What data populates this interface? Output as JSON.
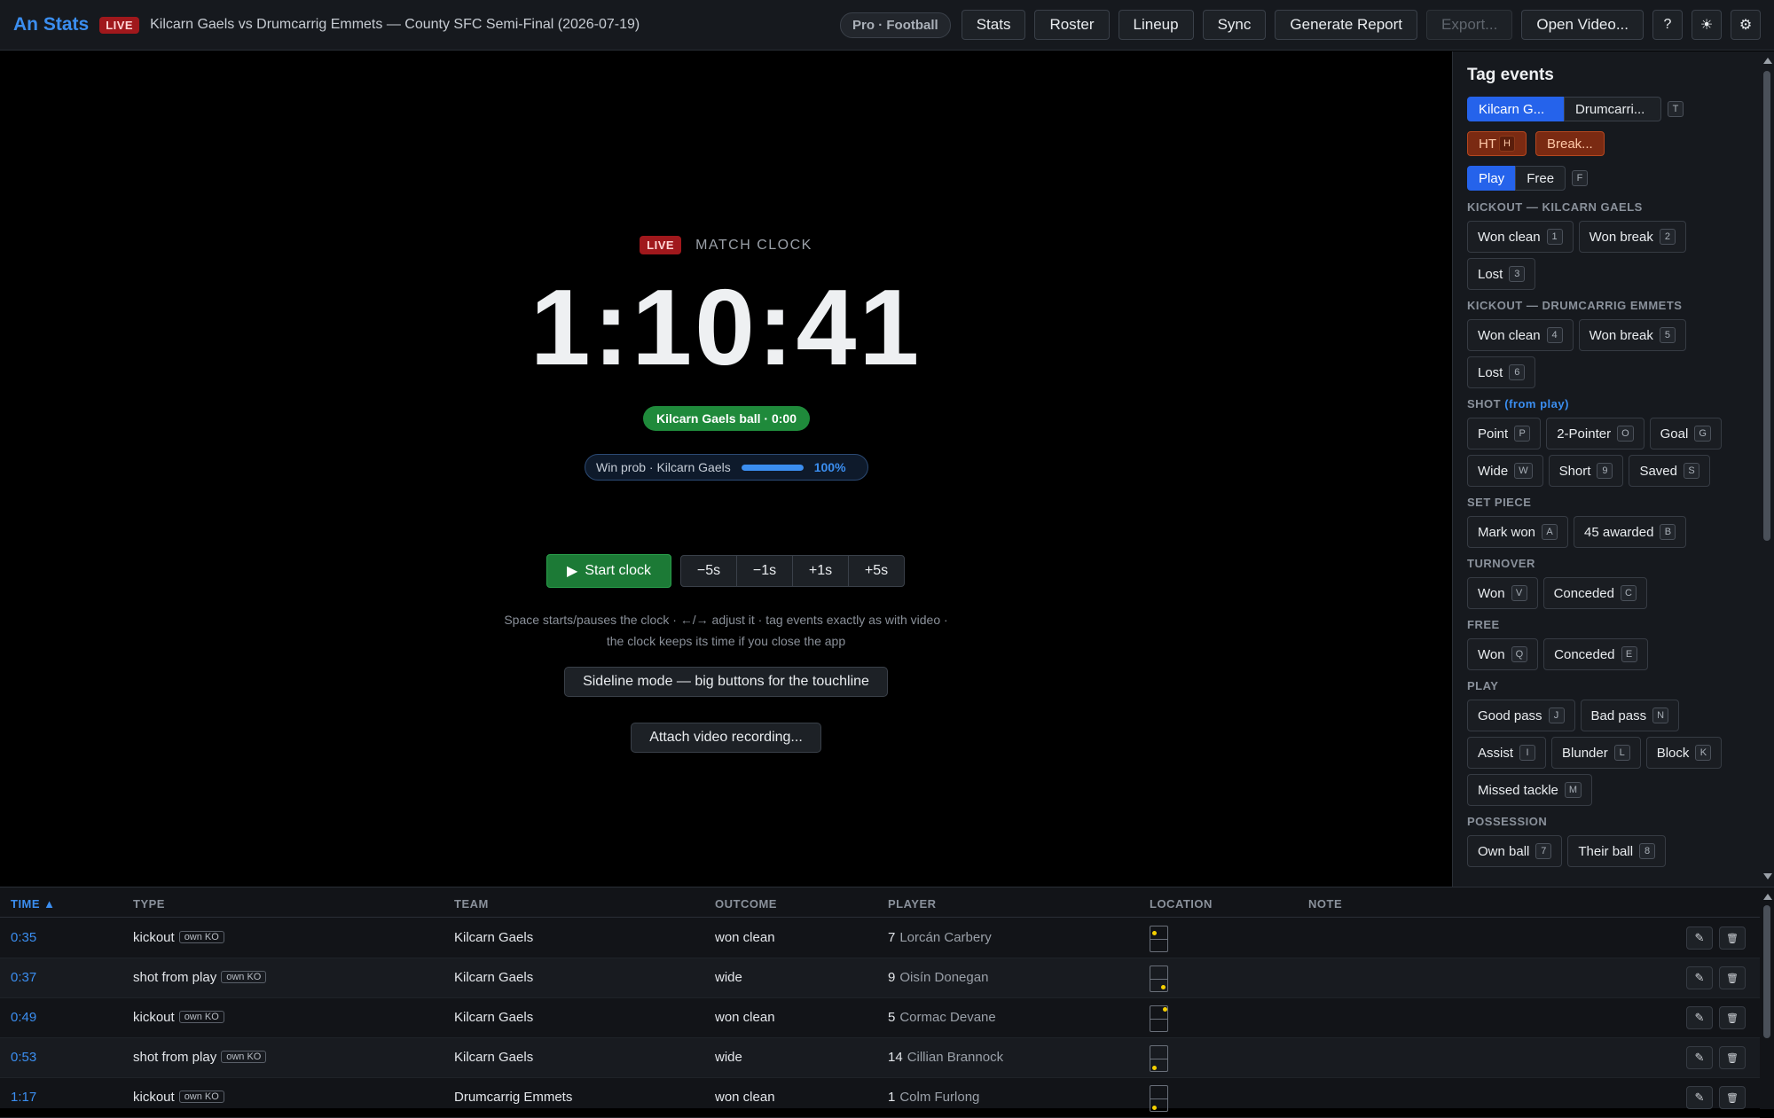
{
  "topbar": {
    "app_name": "An Stats",
    "live_badge": "LIVE",
    "match_title": "Kilcarn Gaels vs Drumcarrig Emmets — County SFC Semi-Final (2026-07-19)",
    "mode_chip": "Pro · Football",
    "buttons": {
      "stats": "Stats",
      "roster": "Roster",
      "lineup": "Lineup",
      "sync": "Sync",
      "generate_report": "Generate Report",
      "export": "Export...",
      "open_video": "Open Video..."
    },
    "icons": {
      "help": "?",
      "theme": "☀",
      "settings": "⚙"
    }
  },
  "stage": {
    "live_badge": "LIVE",
    "clock_label": "MATCH CLOCK",
    "clock_time": "1:10:41",
    "possession": "Kilcarn Gaels ball · 0:00",
    "win_prob_label": "Win prob · Kilcarn Gaels",
    "win_prob_value": "100%",
    "win_prob_fraction": 1.0,
    "start_clock": "Start clock",
    "adjust": [
      "−5s",
      "−1s",
      "+1s",
      "+5s"
    ],
    "hint_line1": "Space starts/pauses the clock · ←/→ adjust it · tag events exactly as with video ·",
    "hint_line2": "the clock keeps its time if you close the app",
    "sideline_mode": "Sideline mode — big buttons for the touchline",
    "attach_video": "Attach video recording..."
  },
  "tag_panel": {
    "title": "Tag events",
    "team_tabs": [
      "Kilcarn G...",
      "Drumcarri..."
    ],
    "team_key": "T",
    "ht_label": "HT",
    "ht_key": "H",
    "break_label": "Break...",
    "mode_tabs": [
      "Play",
      "Free"
    ],
    "mode_key": "F",
    "sections": [
      {
        "label": "KICKOUT — KILCARN GAELS",
        "buttons": [
          {
            "label": "Won clean",
            "key": "1"
          },
          {
            "label": "Won break",
            "key": "2"
          },
          {
            "label": "Lost",
            "key": "3"
          }
        ]
      },
      {
        "label": "KICKOUT — DRUMCARRIG EMMETS",
        "buttons": [
          {
            "label": "Won clean",
            "key": "4"
          },
          {
            "label": "Won break",
            "key": "5"
          },
          {
            "label": "Lost",
            "key": "6"
          }
        ]
      },
      {
        "label": "SHOT",
        "accent": "(from play)",
        "buttons": [
          {
            "label": "Point",
            "key": "P"
          },
          {
            "label": "2-Pointer",
            "key": "O"
          },
          {
            "label": "Goal",
            "key": "G"
          },
          {
            "label": "Wide",
            "key": "W"
          },
          {
            "label": "Short",
            "key": "9"
          },
          {
            "label": "Saved",
            "key": "S"
          }
        ]
      },
      {
        "label": "SET PIECE",
        "buttons": [
          {
            "label": "Mark won",
            "key": "A"
          },
          {
            "label": "45 awarded",
            "key": "B"
          }
        ]
      },
      {
        "label": "TURNOVER",
        "buttons": [
          {
            "label": "Won",
            "key": "V"
          },
          {
            "label": "Conceded",
            "key": "C"
          }
        ]
      },
      {
        "label": "FREE",
        "buttons": [
          {
            "label": "Won",
            "key": "Q"
          },
          {
            "label": "Conceded",
            "key": "E"
          }
        ]
      },
      {
        "label": "PLAY",
        "buttons": [
          {
            "label": "Good pass",
            "key": "J"
          },
          {
            "label": "Bad pass",
            "key": "N"
          },
          {
            "label": "Assist",
            "key": "I"
          },
          {
            "label": "Blunder",
            "key": "L"
          },
          {
            "label": "Block",
            "key": "K"
          },
          {
            "label": "Missed tackle",
            "key": "M"
          }
        ]
      },
      {
        "label": "POSSESSION",
        "buttons": [
          {
            "label": "Own ball",
            "key": "7"
          },
          {
            "label": "Their ball",
            "key": "8"
          }
        ]
      }
    ]
  },
  "events": {
    "columns": {
      "time": "TIME ▲",
      "type": "TYPE",
      "team": "TEAM",
      "outcome": "OUTCOME",
      "player": "PLAYER",
      "location": "LOCATION",
      "note": "NOTE"
    },
    "rows": [
      {
        "time": "0:35",
        "type": "kickout",
        "tag": "own KO",
        "team": "Kilcarn Gaels",
        "outcome": "won clean",
        "number": "7",
        "player": "Lorcán Carbery",
        "location": "top-left"
      },
      {
        "time": "0:37",
        "type": "shot from play",
        "tag": "own KO",
        "team": "Kilcarn Gaels",
        "outcome": "wide",
        "number": "9",
        "player": "Oisín Donegan",
        "location": "bottom-right"
      },
      {
        "time": "0:49",
        "type": "kickout",
        "tag": "own KO",
        "team": "Kilcarn Gaels",
        "outcome": "won clean",
        "number": "5",
        "player": "Cormac Devane",
        "location": "top-right"
      },
      {
        "time": "0:53",
        "type": "shot from play",
        "tag": "own KO",
        "team": "Kilcarn Gaels",
        "outcome": "wide",
        "number": "14",
        "player": "Cillian Brannock",
        "location": "bottom-left"
      },
      {
        "time": "1:17",
        "type": "kickout",
        "tag": "own KO",
        "team": "Drumcarrig Emmets",
        "outcome": "won clean",
        "number": "1",
        "player": "Colm Furlong",
        "location": "bottom-left"
      }
    ]
  },
  "colors": {
    "accent": "#3b8ef0",
    "live": "#a0181c",
    "possession": "#1f8a3b",
    "warn": "#7a2a12",
    "marker": "#f5d000"
  }
}
